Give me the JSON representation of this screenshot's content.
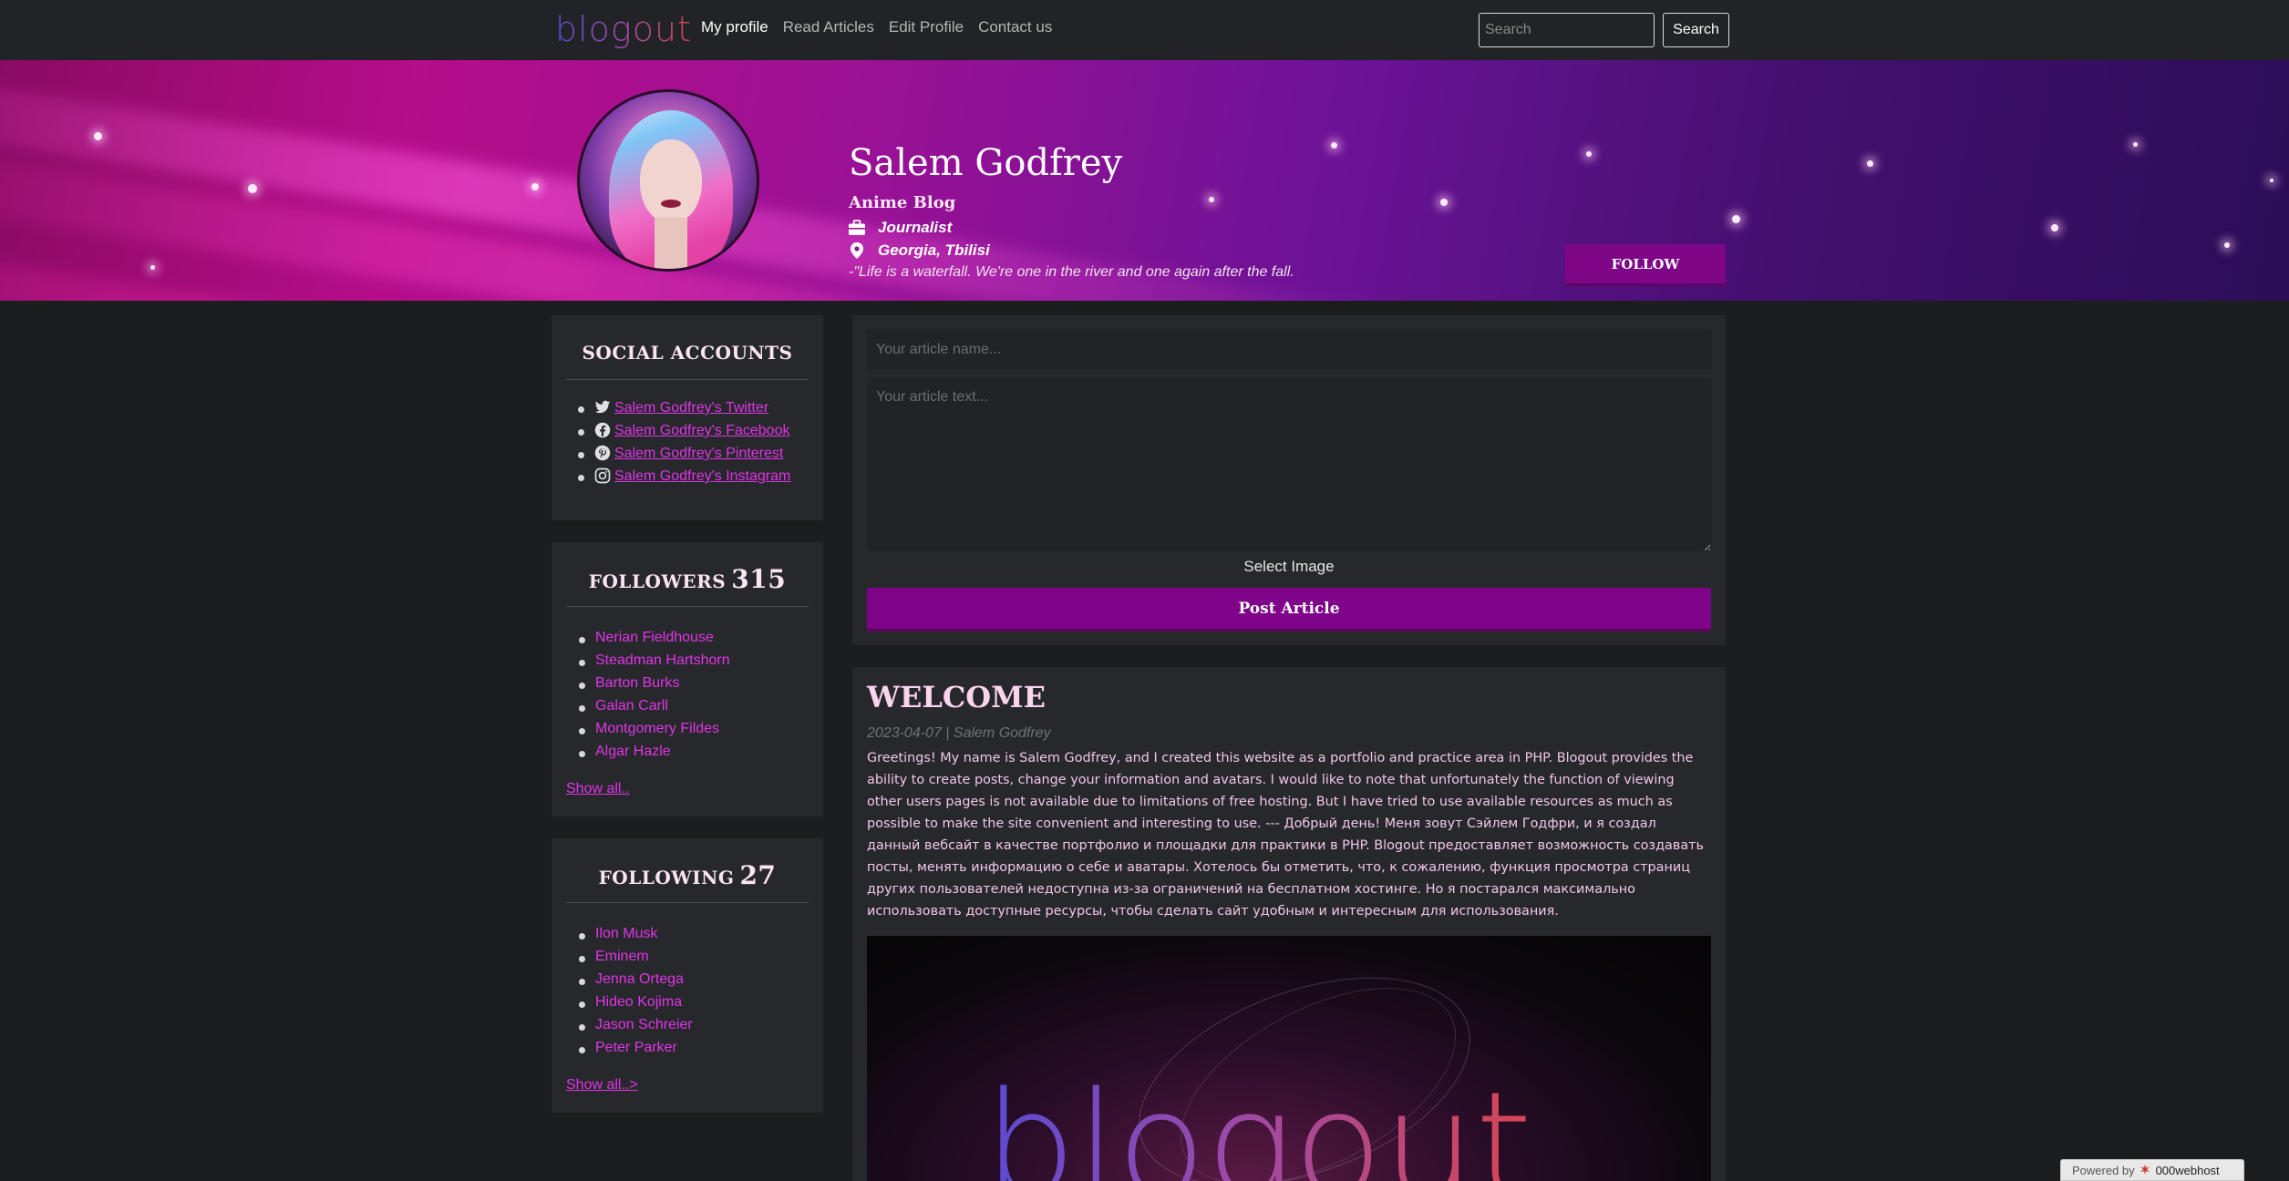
{
  "navbar": {
    "logo": "blogout",
    "links": [
      "My profile",
      "Read Articles",
      "Edit Profile",
      "Contact us"
    ],
    "search_placeholder": "Search",
    "search_button": "Search"
  },
  "profile": {
    "name": "Salem Godfrey",
    "blog": "Anime Blog",
    "job": "Journalist",
    "location": "Georgia, Tbilisi",
    "quote": "-\"Life is a waterfall. We're one in the river and one again after the fall.",
    "follow_label": "FOLLOW"
  },
  "social": {
    "title": "SOCIAL ACCOUNTS",
    "links": [
      {
        "icon": "twitter-icon",
        "label": "Salem Godfrey's Twitter"
      },
      {
        "icon": "facebook-icon",
        "label": "Salem Godfrey's Facebook"
      },
      {
        "icon": "pinterest-icon",
        "label": "Salem Godfrey's Pinterest"
      },
      {
        "icon": "instagram-icon",
        "label": "Salem Godfrey's Instagram"
      }
    ]
  },
  "followers": {
    "title": "FOLLOWERS",
    "count": "315",
    "names": [
      "Nerian Fieldhouse",
      "Steadman Hartshorn",
      "Barton Burks",
      "Galan Carll",
      "Montgomery Fildes",
      "Algar Hazle"
    ],
    "show_all": "Show all.."
  },
  "following": {
    "title": "FOLLOWING",
    "count": "27",
    "names": [
      "Ilon Musk",
      "Eminem",
      "Jenna Ortega",
      "Hideo Kojima",
      "Jason Schreier",
      "Peter Parker"
    ],
    "show_all": "Show all..>"
  },
  "composer": {
    "name_placeholder": "Your article name...",
    "text_placeholder": "Your article text...",
    "select_image": "Select Image",
    "post_button": "Post Article"
  },
  "post": {
    "title": "WELCOME",
    "meta": "2023-04-07 | Salem Godfrey",
    "body": "Greetings! My name is Salem Godfrey, and I created this website as a portfolio and practice area in PHP. Blogout provides the ability to create posts, change your information and avatars. I would like to note that unfortunately the function of viewing other users pages is not available due to limitations of free hosting. But I have tried to use available resources as much as possible to make the site convenient and interesting to use. --- Добрый день! Меня зовут Сэйлем Годфри, и я создал данный вебсайт в качестве портфолио и площадки для практики в PHP. Blogout предоставляет возможность создавать посты, менять информацию о себе и аватары. Хотелось бы отметить, что, к сожалению, функция просмотра страниц других пользователей недоступна из-за ограничений на бесплатном хостинге. Но я постарался максимально использовать доступные ресурсы, чтобы сделать сайт удобным и интересным для использования.",
    "image_wordmark": "blogout"
  },
  "footer": {
    "powered_by": "Powered by",
    "host": "000webhost"
  },
  "colors": {
    "accent": "#80048a",
    "link": "#e034e6",
    "background": "#1c1d1f",
    "card": "#27282c"
  }
}
